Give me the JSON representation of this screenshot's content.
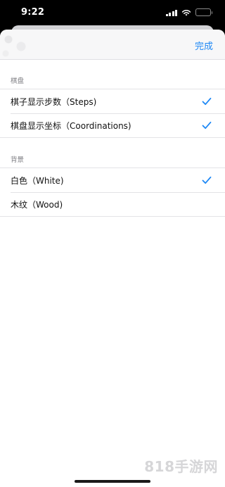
{
  "status_bar": {
    "time": "9:22"
  },
  "nav": {
    "done_label": "完成"
  },
  "sections": [
    {
      "header": "棋盘",
      "items": [
        {
          "label": "棋子显示步数（Steps)",
          "checked": true
        },
        {
          "label": "棋盘显示坐标（Coordinations)",
          "checked": true
        }
      ]
    },
    {
      "header": "背景",
      "items": [
        {
          "label": "白色（White)",
          "checked": true
        },
        {
          "label": "木纹（Wood)",
          "checked": false
        }
      ]
    }
  ],
  "watermark": "818手游网",
  "colors": {
    "accent": "#1e88f5",
    "separator": "#e3e3e6",
    "section_header": "#7e7e83"
  }
}
